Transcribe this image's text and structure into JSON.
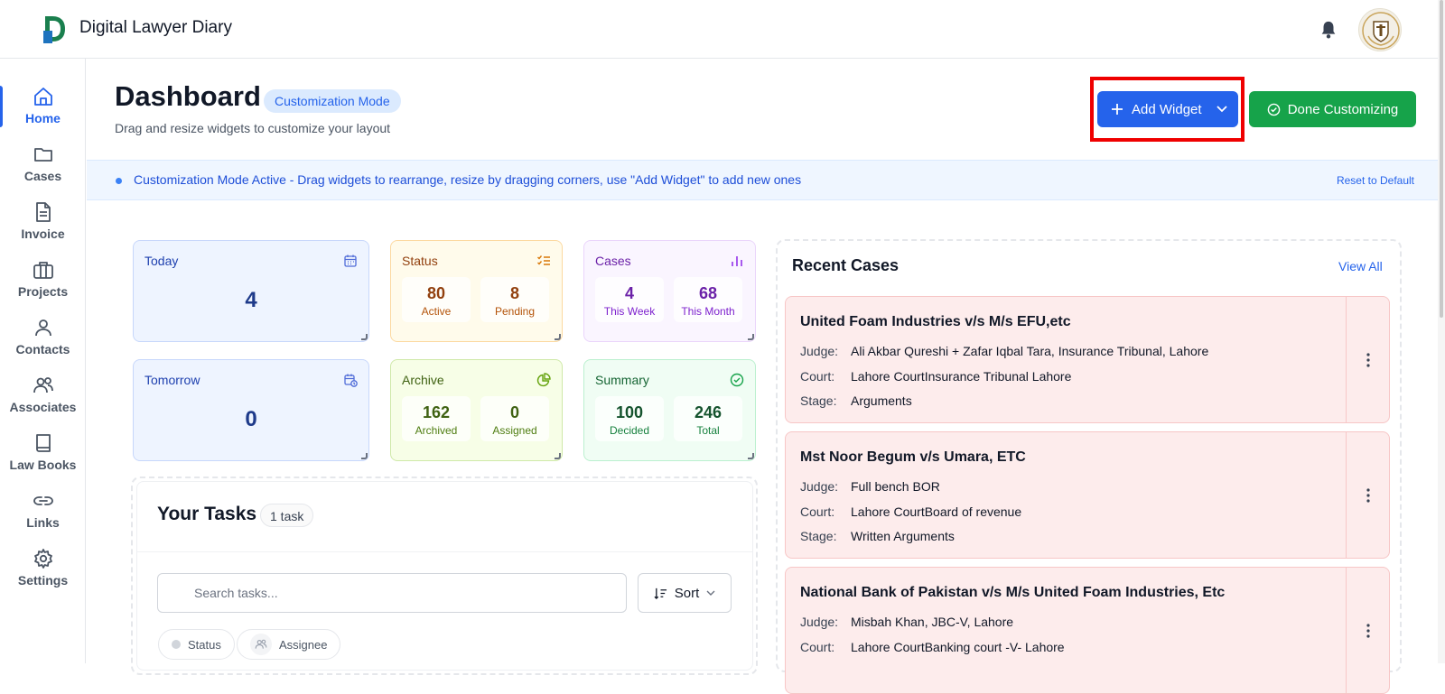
{
  "app": {
    "title": "Digital Lawyer Diary"
  },
  "sidebar": {
    "items": [
      {
        "label": "Home",
        "icon": "home-icon"
      },
      {
        "label": "Cases",
        "icon": "folder-icon"
      },
      {
        "label": "Invoice",
        "icon": "document-icon"
      },
      {
        "label": "Projects",
        "icon": "briefcase-icon"
      },
      {
        "label": "Contacts",
        "icon": "user-icon"
      },
      {
        "label": "Associates",
        "icon": "users-icon"
      },
      {
        "label": "Law Books",
        "icon": "book-icon"
      },
      {
        "label": "Links",
        "icon": "link-icon"
      },
      {
        "label": "Settings",
        "icon": "gear-icon"
      }
    ]
  },
  "header": {
    "title": "Dashboard",
    "mode_badge": "Customization Mode",
    "subtitle": "Drag and resize widgets to customize your layout",
    "add_widget_label": "Add Widget",
    "done_label": "Done Customizing"
  },
  "banner": {
    "text": "Customization Mode Active - Drag widgets to rearrange, resize by dragging corners, use \"Add Widget\" to add new ones",
    "reset_label": "Reset to Default"
  },
  "widgets": {
    "today": {
      "title": "Today",
      "value": "4"
    },
    "tomorrow": {
      "title": "Tomorrow",
      "value": "0"
    },
    "status": {
      "title": "Status",
      "a_value": "80",
      "a_label": "Active",
      "b_value": "8",
      "b_label": "Pending"
    },
    "cases": {
      "title": "Cases",
      "a_value": "4",
      "a_label": "This Week",
      "b_value": "68",
      "b_label": "This Month"
    },
    "archive": {
      "title": "Archive",
      "a_value": "162",
      "a_label": "Archived",
      "b_value": "0",
      "b_label": "Assigned"
    },
    "summary": {
      "title": "Summary",
      "a_value": "100",
      "a_label": "Decided",
      "b_value": "246",
      "b_label": "Total"
    }
  },
  "tasks": {
    "title": "Your Tasks",
    "count": "1 task",
    "search_placeholder": "Search tasks...",
    "sort_label": "Sort",
    "filters": [
      "Status",
      "Assignee"
    ]
  },
  "recent_cases": {
    "title": "Recent Cases",
    "view_all": "View All",
    "labels": {
      "judge": "Judge:",
      "court": "Court:",
      "stage": "Stage:"
    },
    "items": [
      {
        "name": "United Foam Industries v/s M/s EFU,etc",
        "judge": "Ali Akbar Qureshi + Zafar Iqbal Tara, Insurance Tribunal, Lahore",
        "court": "Lahore CourtInsurance Tribunal Lahore",
        "stage": "Arguments"
      },
      {
        "name": "Mst Noor Begum v/s Umara, ETC",
        "judge": "Full bench BOR",
        "court": "Lahore CourtBoard of revenue",
        "stage": "Written Arguments"
      },
      {
        "name": "National Bank of Pakistan v/s M/s United Foam Industries, Etc",
        "judge": "Misbah Khan, JBC-V, Lahore",
        "court": "Lahore CourtBanking court -V- Lahore",
        "stage": ""
      }
    ]
  },
  "colors": {
    "primary": "#2563eb",
    "success": "#16a34a",
    "highlight": "#ef0000"
  }
}
